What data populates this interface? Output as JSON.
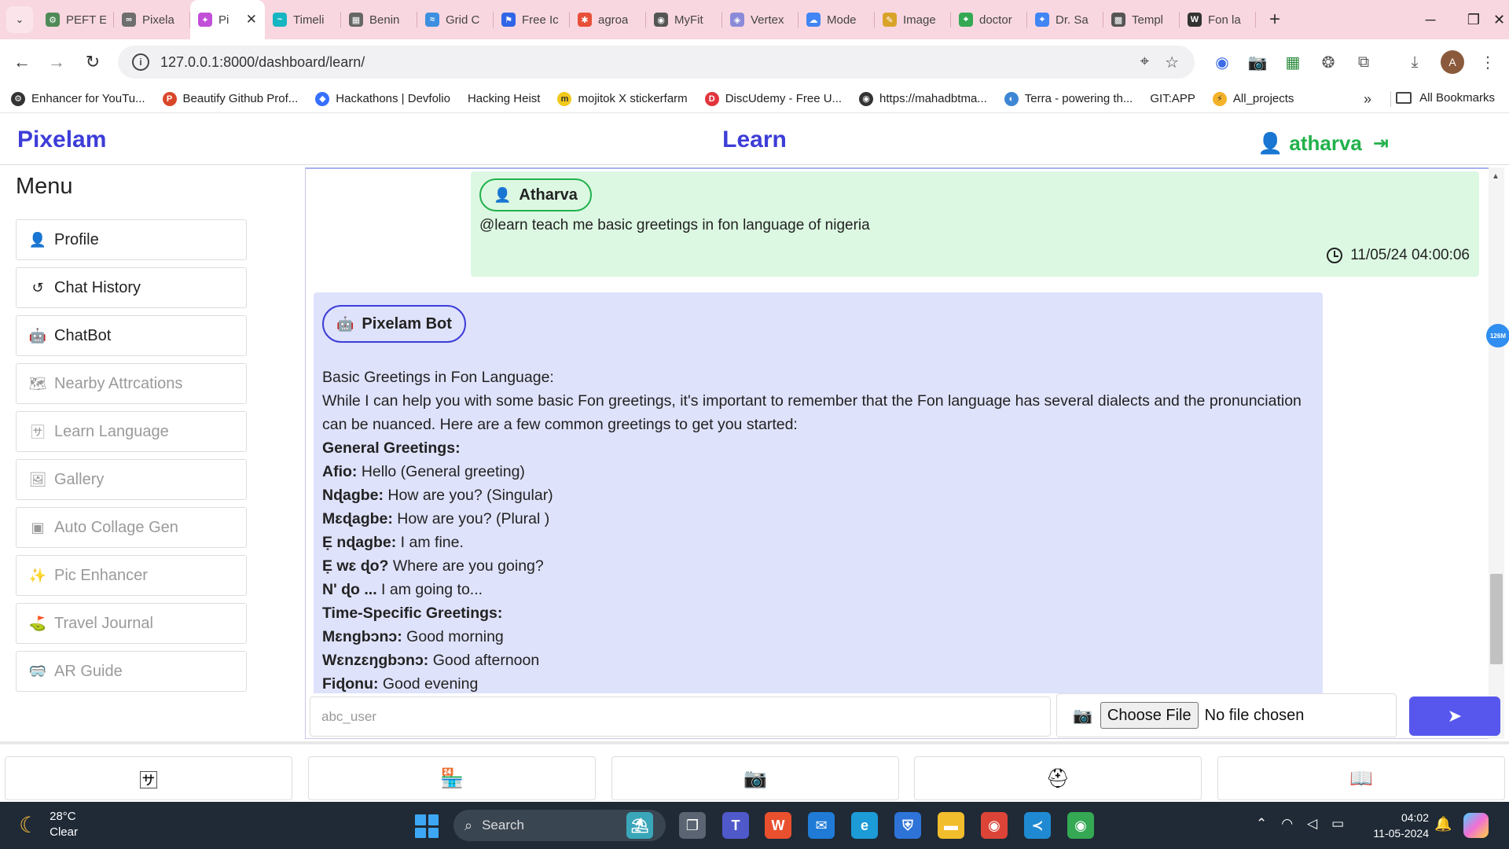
{
  "browser": {
    "tabs": [
      {
        "label": "PEFT E",
        "color": "#4f8a58",
        "glyph": "⚙"
      },
      {
        "label": "Pixela",
        "color": "#6e6e6e",
        "glyph": "∞"
      },
      {
        "label": "Pi",
        "color": "#c24fd8",
        "glyph": "✦",
        "active": true
      },
      {
        "label": "Timeli",
        "color": "#16b5c2",
        "glyph": "~"
      },
      {
        "label": "Benin",
        "color": "#666666",
        "glyph": "▦"
      },
      {
        "label": "Grid C",
        "color": "#3d8fe0",
        "glyph": "≈"
      },
      {
        "label": "Free Ic",
        "color": "#3165e8",
        "glyph": "⚑"
      },
      {
        "label": "agroa",
        "color": "#e8503a",
        "glyph": "✱"
      },
      {
        "label": "MyFit",
        "color": "#555555",
        "glyph": "◉"
      },
      {
        "label": "Vertex",
        "color": "#8a8ad8",
        "glyph": "◈"
      },
      {
        "label": "Mode",
        "color": "#4285f4",
        "glyph": "☁"
      },
      {
        "label": "Image",
        "color": "#d9a32a",
        "glyph": "✎"
      },
      {
        "label": "doctor",
        "color": "#34a853",
        "glyph": "⌖"
      },
      {
        "label": "Dr. Sa",
        "color": "#4285f4",
        "glyph": "⌖"
      },
      {
        "label": "Templ",
        "color": "#555555",
        "glyph": "▩"
      },
      {
        "label": "Fon la",
        "color": "#333333",
        "glyph": "W"
      }
    ],
    "new_tab": "+",
    "window_controls": {
      "minimize": "─",
      "maximize": "❐",
      "close": "✕"
    },
    "url": "127.0.0.1:8000/dashboard/learn/",
    "bookmarks": [
      {
        "label": "Enhancer for YouTu...",
        "color": "#333333",
        "glyph": "⚙"
      },
      {
        "label": "Beautify Github Prof...",
        "color": "#d9472b",
        "glyph": "P"
      },
      {
        "label": "Hackathons | Devfolio",
        "color": "#3770ff",
        "glyph": "◆"
      },
      {
        "label": "Hacking Heist",
        "color": "#ffffff",
        "glyph": ""
      },
      {
        "label": "mojitok X stickerfarm",
        "color": "#f2c81c",
        "glyph": "m"
      },
      {
        "label": "DiscUdemy - Free U...",
        "color": "#e2343d",
        "glyph": "D"
      },
      {
        "label": "https://mahadbtma...",
        "color": "#333333",
        "glyph": "◉"
      },
      {
        "label": "Terra - powering th...",
        "color": "#3c86d4",
        "glyph": "◐"
      },
      {
        "label": "GIT:APP",
        "color": "#ffffff",
        "glyph": ""
      },
      {
        "label": "All_projects",
        "color": "#f3b22a",
        "glyph": "⚡"
      }
    ],
    "bookmarks_more": "»",
    "all_bookmarks": "All Bookmarks"
  },
  "app": {
    "brand": "Pixelam",
    "page_title": "Learn",
    "username": "atharva"
  },
  "sidebar": {
    "title": "Menu",
    "items": [
      {
        "label": "Profile",
        "icon": "user-icon",
        "glyph": "👤",
        "enabled": true
      },
      {
        "label": "Chat History",
        "icon": "history-icon",
        "glyph": "↺",
        "enabled": true
      },
      {
        "label": "ChatBot",
        "icon": "robot-icon",
        "glyph": "🤖",
        "enabled": true
      },
      {
        "label": "Nearby Attrcations",
        "icon": "map-icon",
        "glyph": "🗺",
        "enabled": false
      },
      {
        "label": "Learn Language",
        "icon": "language-icon",
        "glyph": "🈂",
        "enabled": false
      },
      {
        "label": "Gallery",
        "icon": "images-icon",
        "glyph": "🖼",
        "enabled": false
      },
      {
        "label": "Auto Collage Gen",
        "icon": "image-icon",
        "glyph": "▣",
        "enabled": false
      },
      {
        "label": "Pic Enhancer",
        "icon": "magic-wand-icon",
        "glyph": "✨",
        "enabled": false
      },
      {
        "label": "Travel Journal",
        "icon": "route-icon",
        "glyph": "⛳",
        "enabled": false
      },
      {
        "label": "AR Guide",
        "icon": "vr-headset-icon",
        "glyph": "🥽",
        "enabled": false
      }
    ]
  },
  "chat": {
    "user_message": {
      "sender": "Atharva",
      "text": "@learn teach me basic greetings in fon language of nigeria",
      "timestamp": "11/05/24 04:00:06"
    },
    "bot_message": {
      "sender": "Pixelam Bot",
      "lines": [
        {
          "bold": "",
          "text": "Basic Greetings in Fon Language:"
        },
        {
          "bold": "",
          "text": "While I can help you with some basic Fon greetings, it's important to remember that the Fon language has several dialects and the pronunciation can be nuanced. Here are a few common greetings to get you started:"
        },
        {
          "bold": "General Greetings:",
          "text": ""
        },
        {
          "bold": "Afio:",
          "text": " Hello (General greeting)"
        },
        {
          "bold": "Nɖagbe:",
          "text": " How are you? (Singular)"
        },
        {
          "bold": "Mɛɖagbe:",
          "text": " How are you? (Plural )"
        },
        {
          "bold": "Ẹ nɖagbe:",
          "text": " I am fine."
        },
        {
          "bold": "Ẹ wɛ ɖo?",
          "text": " Where are you going?"
        },
        {
          "bold": "N' ɖo ...",
          "text": " I am going to..."
        },
        {
          "bold": "Time-Specific Greetings:",
          "text": ""
        },
        {
          "bold": "Mɛngbɔnɔ:",
          "text": " Good morning"
        },
        {
          "bold": "Wɛnzɛŋgbɔnɔ:",
          "text": " Good afternoon"
        },
        {
          "bold": "Fiɖonu:",
          "text": " Good evening"
        }
      ]
    },
    "scroll_badge": "126M"
  },
  "composer": {
    "placeholder": "abc_user",
    "choose_file": "Choose File",
    "no_file": "No file chosen"
  },
  "bottom_nav": [
    {
      "name": "language-icon",
      "glyph": "🈂"
    },
    {
      "name": "store-icon",
      "glyph": "🏪"
    },
    {
      "name": "camera-icon",
      "glyph": "📷"
    },
    {
      "name": "medkit-icon",
      "glyph": "⛑"
    },
    {
      "name": "book-icon",
      "glyph": "📖"
    }
  ],
  "taskbar": {
    "temperature": "28°C",
    "weather": "Clear",
    "search": "Search",
    "time": "04:02",
    "date": "11-05-2024",
    "apps": [
      {
        "name": "beach-widget-icon",
        "glyph": "⛱",
        "color": "#3aa6b9"
      },
      {
        "name": "task-view-icon",
        "glyph": "❐",
        "color": "#5a6472"
      },
      {
        "name": "teams-icon",
        "glyph": "T",
        "color": "#5059c9"
      },
      {
        "name": "office-icon",
        "glyph": "W",
        "color": "#e8502e"
      },
      {
        "name": "mail-icon",
        "glyph": "✉",
        "color": "#1f7bd6"
      },
      {
        "name": "edge-icon",
        "glyph": "e",
        "color": "#1c9bd7"
      },
      {
        "name": "security-icon",
        "glyph": "⛨",
        "color": "#2e74d8"
      },
      {
        "name": "file-explorer-icon",
        "glyph": "▬",
        "color": "#f1bd2c"
      },
      {
        "name": "chrome-icon",
        "glyph": "◉",
        "color": "#db4437"
      },
      {
        "name": "vscode-icon",
        "glyph": "≺",
        "color": "#1f8ad2"
      },
      {
        "name": "chrome-profile-icon",
        "glyph": "◉",
        "color": "#34a853"
      }
    ]
  }
}
